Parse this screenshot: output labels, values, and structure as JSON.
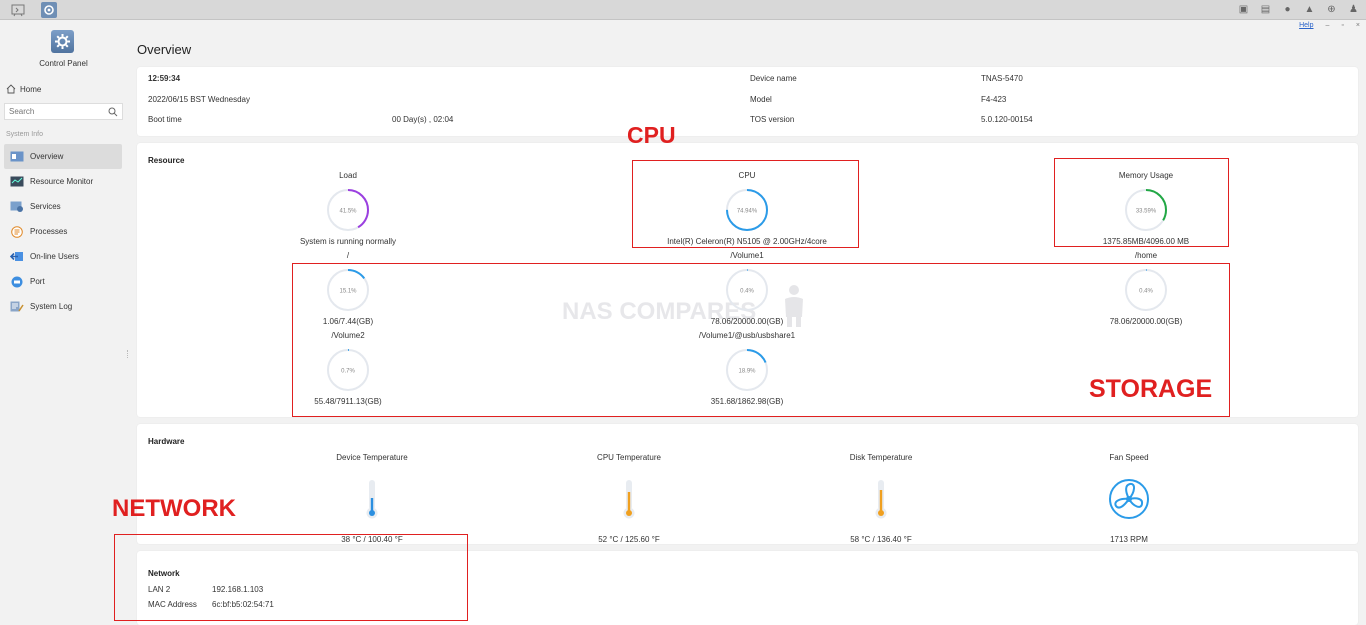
{
  "topbar": {
    "tray_icons": [
      "printer-icon",
      "monitor-icon",
      "chat-icon",
      "bell-icon",
      "globe-icon",
      "user-icon"
    ]
  },
  "window": {
    "help": "Help",
    "minimize": "–",
    "restore": "▫",
    "close": "×"
  },
  "sidebar": {
    "app_title": "Control Panel",
    "home": "Home",
    "search_placeholder": "Search",
    "section": "System Info",
    "items": [
      {
        "label": "Overview",
        "icon": "overview-icon",
        "active": true
      },
      {
        "label": "Resource Monitor",
        "icon": "resource-monitor-icon"
      },
      {
        "label": "Services",
        "icon": "services-icon"
      },
      {
        "label": "Processes",
        "icon": "processes-icon"
      },
      {
        "label": "On-line Users",
        "icon": "online-users-icon"
      },
      {
        "label": "Port",
        "icon": "port-icon"
      },
      {
        "label": "System Log",
        "icon": "system-log-icon"
      }
    ]
  },
  "page_title": "Overview",
  "info": {
    "time": "12:59:34",
    "date": "2022/06/15 BST Wednesday",
    "boot_label": "Boot time",
    "boot_value": "00 Day(s) , 02:04",
    "device_name_label": "Device name",
    "device_name_value": "TNAS-5470",
    "model_label": "Model",
    "model_value": "F4-423",
    "tos_label": "TOS version",
    "tos_value": "5.0.120-00154"
  },
  "resource": {
    "title": "Resource",
    "load": {
      "label": "Load",
      "percent": "41.5%",
      "value": 41.5,
      "color": "#9b3fe0",
      "sub": "System is running normally"
    },
    "cpu": {
      "label": "CPU",
      "percent": "74.94%",
      "value": 74.94,
      "color": "#2b9be8",
      "sub": "Intel(R) Celeron(R) N5105 @ 2.00GHz/4core"
    },
    "memory": {
      "label": "Memory Usage",
      "percent": "33.59%",
      "value": 33.59,
      "color": "#22a845",
      "sub": "1375.85MB/4096.00 MB"
    },
    "volumes": [
      {
        "label": "/",
        "percent": "15.1%",
        "value": 15.1,
        "sub": "1.06/7.44(GB)"
      },
      {
        "label": "/Volume1",
        "percent": "0.4%",
        "value": 0.4,
        "sub": "78.06/20000.00(GB)"
      },
      {
        "label": "/home",
        "percent": "0.4%",
        "value": 0.4,
        "sub": "78.06/20000.00(GB)"
      },
      {
        "label": "/Volume2",
        "percent": "0.7%",
        "value": 0.7,
        "sub": "55.48/7911.13(GB)"
      },
      {
        "label": "/Volume1/@usb/usbshare1",
        "percent": "18.9%",
        "value": 18.9,
        "sub": "351.68/1862.98(GB)"
      }
    ],
    "volume_color": "#2b9be8"
  },
  "hardware": {
    "title": "Hardware",
    "device_temp": {
      "label": "Device Temperature",
      "value": "38 °C / 100.40 °F",
      "color": "#2b8fe0"
    },
    "cpu_temp": {
      "label": "CPU Temperature",
      "value": "52 °C / 125.60 °F",
      "color": "#f0a020"
    },
    "disk_temp": {
      "label": "Disk Temperature",
      "value": "58 °C / 136.40 °F",
      "color": "#f0a020"
    },
    "fan": {
      "label": "Fan Speed",
      "value": "1713 RPM",
      "color": "#2b9be8"
    }
  },
  "network": {
    "title": "Network",
    "lan_label": "LAN 2",
    "lan_value": "192.168.1.103",
    "mac_label": "MAC Address",
    "mac_value": "6c:bf:b5:02:54:71"
  },
  "watermark": "NAS COMPARES",
  "annotations": {
    "cpu": "CPU",
    "storage": "STORAGE",
    "network": "NETWORK",
    "color": "#e02020"
  }
}
